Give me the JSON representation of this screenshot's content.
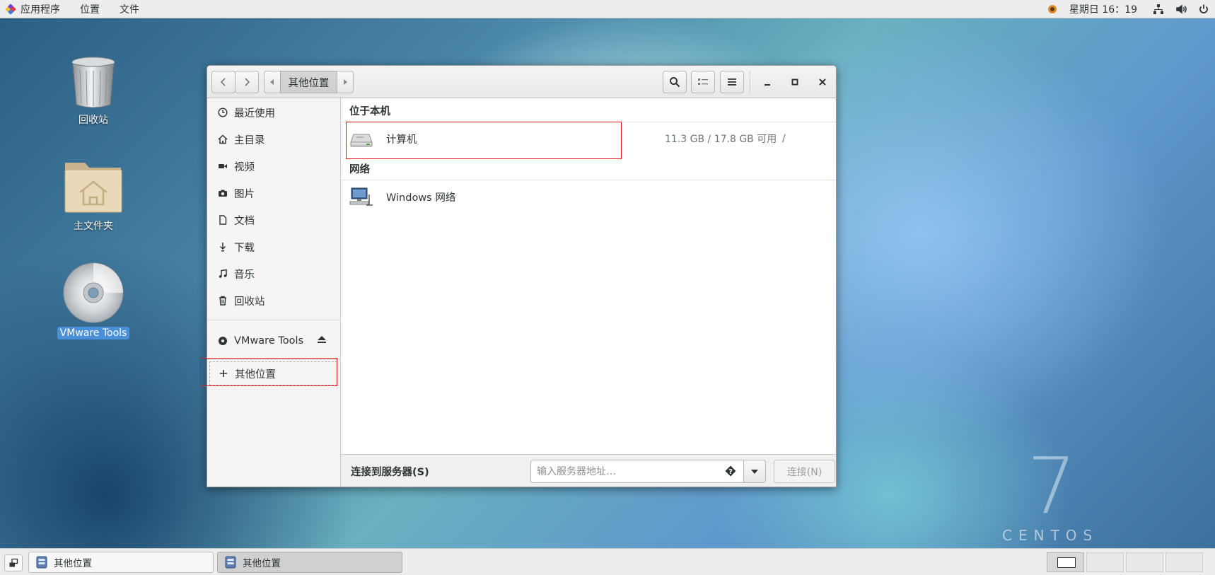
{
  "topbar": {
    "menus": [
      "应用程序",
      "位置",
      "文件"
    ],
    "clock": "星期日 16：19"
  },
  "desktop": {
    "icons": [
      {
        "label": "回收站",
        "icon": "trash-icon"
      },
      {
        "label": "主文件夹",
        "icon": "home-folder-icon"
      },
      {
        "label": "VMware Tools",
        "icon": "disc-icon",
        "selected": true
      }
    ]
  },
  "window": {
    "pathbar": {
      "current": "其他位置"
    },
    "sidebar": {
      "items": [
        {
          "label": "最近使用",
          "icon": "clock-icon"
        },
        {
          "label": "主目录",
          "icon": "home-icon"
        },
        {
          "label": "视频",
          "icon": "video-icon"
        },
        {
          "label": "图片",
          "icon": "camera-icon"
        },
        {
          "label": "文档",
          "icon": "document-icon"
        },
        {
          "label": "下载",
          "icon": "download-icon"
        },
        {
          "label": "音乐",
          "icon": "music-icon"
        },
        {
          "label": "回收站",
          "icon": "trash-icon"
        }
      ],
      "device": {
        "label": "VMware Tools",
        "icon": "disc-icon"
      },
      "other": {
        "label": "其他位置",
        "icon": "plus-icon"
      }
    },
    "content": {
      "local_title": "位于本机",
      "computer": {
        "name": "计算机",
        "space": "11.3 GB / 17.8 GB 可用",
        "mount": "/"
      },
      "network_title": "网络",
      "network": {
        "name": "Windows 网络"
      }
    },
    "connect": {
      "label": "连接到服务器(S)",
      "placeholder": "输入服务器地址…",
      "button": "连接(N)"
    }
  },
  "taskbar": {
    "tasks": [
      {
        "label": "其他位置",
        "active": false
      },
      {
        "label": "其他位置",
        "active": true
      }
    ]
  },
  "branding": {
    "seven": "7",
    "word": "CENTOS"
  },
  "colors": {
    "highlight_box": "#e0141e",
    "selection": "#4a90d9"
  }
}
